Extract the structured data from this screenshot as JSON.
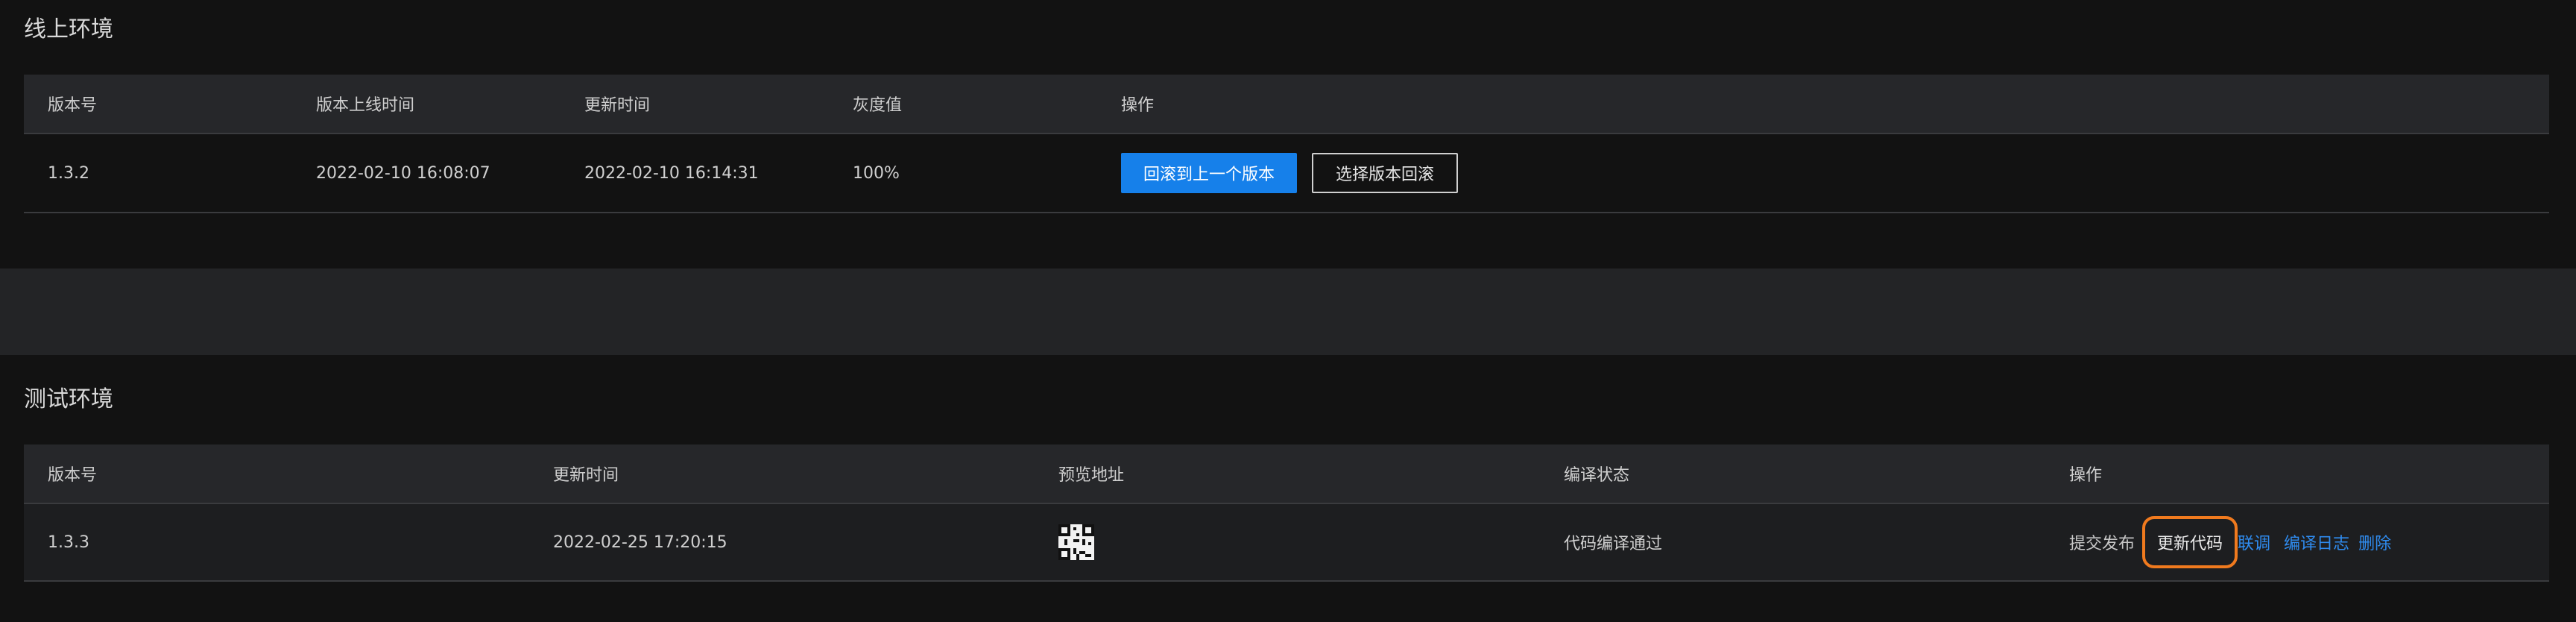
{
  "online": {
    "title": "线上环境",
    "headers": {
      "version": "版本号",
      "online_time": "版本上线时间",
      "update_time": "更新时间",
      "gray": "灰度值",
      "ops": "操作"
    },
    "rows": [
      {
        "version": "1.3.2",
        "online_time": "2022-02-10 16:08:07",
        "update_time": "2022-02-10 16:14:31",
        "gray": "100%",
        "rollback_prev": "回滚到上一个版本",
        "rollback_select": "选择版本回滚"
      }
    ]
  },
  "test": {
    "title": "测试环境",
    "headers": {
      "version": "版本号",
      "update_time": "更新时间",
      "preview": "预览地址",
      "build_status": "编译状态",
      "ops": "操作"
    },
    "rows": [
      {
        "version": "1.3.3",
        "update_time": "2022-02-25 17:20:15",
        "preview_icon": "qr-code-icon",
        "build_status": "代码编译通过",
        "submit": "提交发布",
        "update_code": "更新代码",
        "debug": "联调",
        "build_log": "编译日志",
        "delete": "删除"
      }
    ]
  },
  "colors": {
    "primary": "#1680ea",
    "link": "#2f8cf0",
    "highlight": "#f07a1e",
    "background": "#121212",
    "header_bg": "#26272a"
  }
}
